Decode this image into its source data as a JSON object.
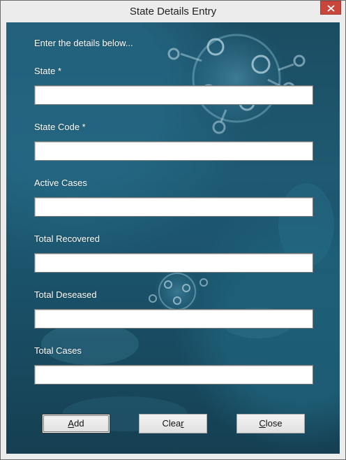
{
  "window": {
    "title": "State Details Entry",
    "close_glyph": "✕"
  },
  "form": {
    "intro": "Enter the details below...",
    "fields": [
      {
        "label": "State *",
        "value": ""
      },
      {
        "label": "State Code *",
        "value": ""
      },
      {
        "label": "Active Cases",
        "value": ""
      },
      {
        "label": "Total Recovered",
        "value": ""
      },
      {
        "label": "Total Deseased",
        "value": ""
      },
      {
        "label": "Total Cases",
        "value": ""
      }
    ]
  },
  "buttons": {
    "add": {
      "label": "Add",
      "mnemonic": "A",
      "rest": "dd"
    },
    "clear": {
      "label": "Clear",
      "pre": "Clea",
      "mnemonic": "r"
    },
    "close": {
      "label": "Close",
      "mnemonic": "C",
      "rest": "lose"
    }
  },
  "colors": {
    "background": "#1e5a72",
    "close_button": "#c9463d",
    "label_text": "#ffffff"
  },
  "icons": {
    "window_close": "close-icon",
    "background": "virus-image"
  }
}
